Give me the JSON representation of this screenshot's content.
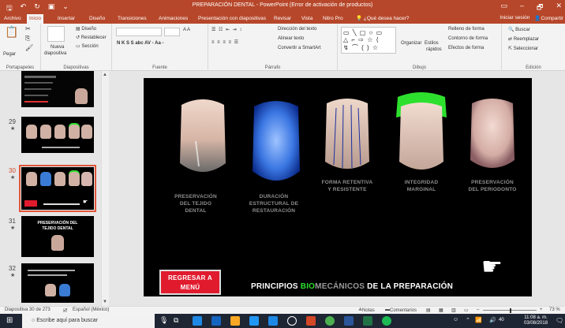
{
  "window": {
    "title": "PREPARACIÓN DENTAL - PowerPoint (Error de activación de productos)",
    "controls": [
      "▭",
      "–",
      "🗗",
      "✕"
    ]
  },
  "ribbon_tabs": [
    "Archivo",
    "Inicio",
    "Insertar",
    "Diseño",
    "Transiciones",
    "Animaciones",
    "Presentación con diapositivas",
    "Revisar",
    "Vista",
    "Nitro Pro"
  ],
  "tell_me": "¿Qué desea hacer?",
  "sign_in": "Iniciar sesión",
  "share": "Compartir",
  "ribbon": {
    "clipboard": {
      "paste": "Pegar",
      "label": "Portapapeles"
    },
    "slides": {
      "new_slide_1": "Nueva",
      "new_slide_2": "diapositiva",
      "layout": "Diseño",
      "reset": "Restablecer",
      "section": "Sección",
      "label": "Diapositivas"
    },
    "font": {
      "label": "Fuente",
      "format_buttons": "N K S S abc AV - Aa -",
      "size_buttons": "A A"
    },
    "paragraph": {
      "label": "Párrafo",
      "text_direction": "Dirección del texto",
      "align_text": "Alinear texto",
      "smartart": "Convertir a SmartArt"
    },
    "drawing": {
      "label": "Dibujo",
      "arrange": "Organizar",
      "styles_1": "Estilos",
      "styles_2": "rápidos",
      "fill": "Relleno de forma",
      "outline": "Contorno de forma",
      "effects": "Efectos de forma"
    },
    "editing": {
      "label": "Edición",
      "find": "Buscar",
      "replace": "Reemplazar",
      "select": "Seleccionar"
    }
  },
  "thumbnails": [
    {
      "number": "29",
      "star": "★"
    },
    {
      "number": "30",
      "star": "★"
    },
    {
      "number": "31",
      "star": "★",
      "title_1": "PRESERVACIÓN DEL",
      "title_2": "TEJIDO DENTAL"
    },
    {
      "number": "32",
      "star": "★"
    }
  ],
  "slide": {
    "captions": [
      {
        "l1": "PRESERVACIÓN",
        "l2": "DEL TEJIDO",
        "l3": "DENTAL"
      },
      {
        "l1": "DURACIÓN",
        "l2": "ESTRUCTURAL DE",
        "l3": "RESTAURACIÓN"
      },
      {
        "l1": "FORMA RETENTIVA",
        "l2": "Y RESISTENTE"
      },
      {
        "l1": "INTEGRIDAD",
        "l2": "MARGINAL"
      },
      {
        "l1": "PRESERVACIÓN",
        "l2": "DEL PERIODONTO"
      }
    ],
    "back_button_1": "REGRESAR A",
    "back_button_2": "MENÚ",
    "title_part1": "PRINCIPIOS ",
    "title_part2": "BIO",
    "title_part3": "MECÁNICOS",
    "title_part4": " DE LA PREPARACIÓN",
    "colors": {
      "title_accent": "#2ee02e",
      "button": "#e11b2e",
      "ribbon": "#b7472a"
    }
  },
  "status": {
    "slide_info": "Diapositiva 30 de 273",
    "language": "Español (México)",
    "notes": "Notas",
    "comments": "Comentarios",
    "zoom": "73 %"
  },
  "taskbar": {
    "search_placeholder": "Escribe aquí para buscar",
    "time": "11:08 a. m.",
    "date": "03/08/2018",
    "volume": "40"
  }
}
